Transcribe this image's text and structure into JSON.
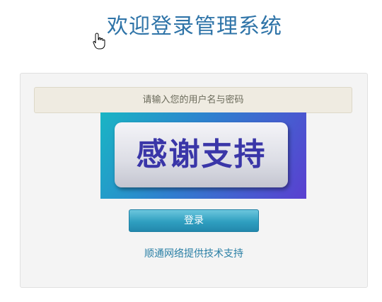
{
  "page": {
    "title": "欢迎登录管理系统"
  },
  "login_panel": {
    "notice": "请输入您的用户名与密码",
    "banner_text": "感谢支持",
    "login_button_label": "登录",
    "support_link_text": "顺通网络提供技术支持"
  },
  "icons": {
    "cursor": "hand-pointer-icon"
  },
  "colors": {
    "title": "#2f74a8",
    "button": "#2f9fc0",
    "link": "#2a7fa5",
    "banner_text": "#3a36a8"
  }
}
